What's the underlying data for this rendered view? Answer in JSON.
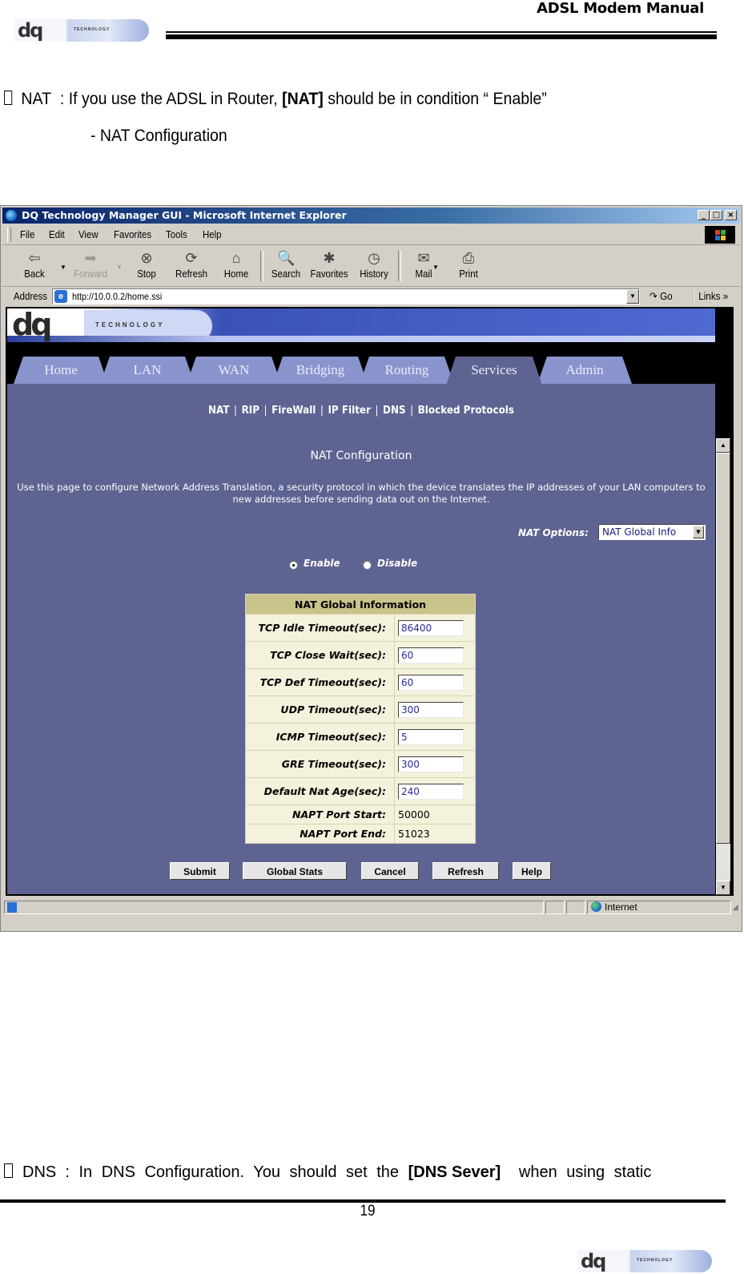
{
  "doc": {
    "header_title": "ADSL Modem Manual",
    "logo_text": "dq",
    "logo_subtext": "TECHNOLOGY",
    "nat_intro_term": "NAT",
    "nat_intro_pre": ": If you use the ADSL in Router, ",
    "nat_intro_bold": "[NAT]",
    "nat_intro_post": " should be in condition “ Enable”",
    "nat_sub_heading": "- NAT Configuration",
    "dns_term": "DNS",
    "dns_pre": ": In DNS Configuration. You should set the ",
    "dns_bold": "[DNS Sever]",
    "dns_post": " when using static",
    "page_number": "19"
  },
  "browser": {
    "title": "DQ Technology Manager GUI - Microsoft Internet Explorer",
    "window_buttons": {
      "minimize": "_",
      "maximize": "□",
      "close": "×"
    },
    "menu": [
      "File",
      "Edit",
      "View",
      "Favorites",
      "Tools",
      "Help"
    ],
    "toolbar": [
      {
        "label": "Back",
        "icon": "⇦",
        "enabled": true
      },
      {
        "label": "Forward",
        "icon": "➡",
        "enabled": false
      },
      {
        "label": "Stop",
        "icon": "⊗",
        "enabled": true
      },
      {
        "label": "Refresh",
        "icon": "⟳",
        "enabled": true
      },
      {
        "label": "Home",
        "icon": "⌂",
        "enabled": true
      },
      {
        "label": "Search",
        "icon": "🔍",
        "enabled": true
      },
      {
        "label": "Favorites",
        "icon": "✱",
        "enabled": true
      },
      {
        "label": "History",
        "icon": "◷",
        "enabled": true
      },
      {
        "label": "Mail",
        "icon": "✉",
        "enabled": true
      },
      {
        "label": "Print",
        "icon": "⎙",
        "enabled": true
      }
    ],
    "address_label": "Address",
    "address_url": "http://10.0.0.2/home.ssi",
    "go_label": "Go",
    "links_label": "Links »",
    "status_zone": "Internet"
  },
  "webpage": {
    "brand": "dq",
    "brand_sub": "TECHNOLOGY",
    "tabs": [
      {
        "label": "Home",
        "active": false
      },
      {
        "label": "LAN",
        "active": false
      },
      {
        "label": "WAN",
        "active": false
      },
      {
        "label": "Bridging",
        "active": false
      },
      {
        "label": "Routing",
        "active": false
      },
      {
        "label": "Services",
        "active": true
      },
      {
        "label": "Admin",
        "active": false
      }
    ],
    "subnav": [
      "NAT",
      "RIP",
      "FireWall",
      "IP Filter",
      "DNS",
      "Blocked Protocols"
    ],
    "subnav_separator": "|",
    "title": "NAT Configuration",
    "description": "Use this page to configure Network Address Translation, a security protocol in which the device translates the IP addresses of your LAN computers to new addresses before sending data out on the Internet.",
    "options_label": "NAT Options:",
    "options_selected": "NAT Global Info",
    "radio_enable": "Enable",
    "radio_disable": "Disable",
    "nat_enabled": true,
    "table_header": "NAT Global Information",
    "rows": [
      {
        "label": "TCP Idle Timeout(sec):",
        "value": "86400",
        "editable": true
      },
      {
        "label": "TCP Close Wait(sec):",
        "value": "60",
        "editable": true
      },
      {
        "label": "TCP Def Timeout(sec):",
        "value": "60",
        "editable": true
      },
      {
        "label": "UDP Timeout(sec):",
        "value": "300",
        "editable": true
      },
      {
        "label": "ICMP Timeout(sec):",
        "value": "5",
        "editable": true
      },
      {
        "label": "GRE Timeout(sec):",
        "value": "300",
        "editable": true
      },
      {
        "label": "Default Nat Age(sec):",
        "value": "240",
        "editable": true
      },
      {
        "label": "NAPT Port Start:",
        "value": "50000",
        "editable": false
      },
      {
        "label": "NAPT Port End:",
        "value": "51023",
        "editable": false
      }
    ],
    "buttons": [
      "Submit",
      "Global Stats",
      "Cancel",
      "Refresh",
      "Help"
    ]
  },
  "colors": {
    "page_bg": "#5f6391",
    "tab_bg": "#8a94cc",
    "table_header_bg": "#c9c48c",
    "table_bg": "#f4f1dc",
    "titlebar_start": "#0a246a"
  }
}
